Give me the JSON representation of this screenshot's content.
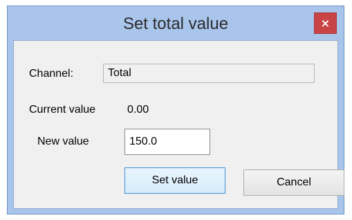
{
  "dialog": {
    "title": "Set total value",
    "close_label": "×"
  },
  "form": {
    "channel_label": "Channel:",
    "channel_value": "Total",
    "current_label": "Current value",
    "current_value": "0.00",
    "new_value_label": "New value",
    "new_value": "150.0"
  },
  "buttons": {
    "set_value": "Set value",
    "cancel": "Cancel"
  },
  "colors": {
    "frame": "#a9c5ec",
    "close_button": "#c94545",
    "client_background": "#f0f0f0",
    "default_button_border": "#3d8fd6"
  }
}
